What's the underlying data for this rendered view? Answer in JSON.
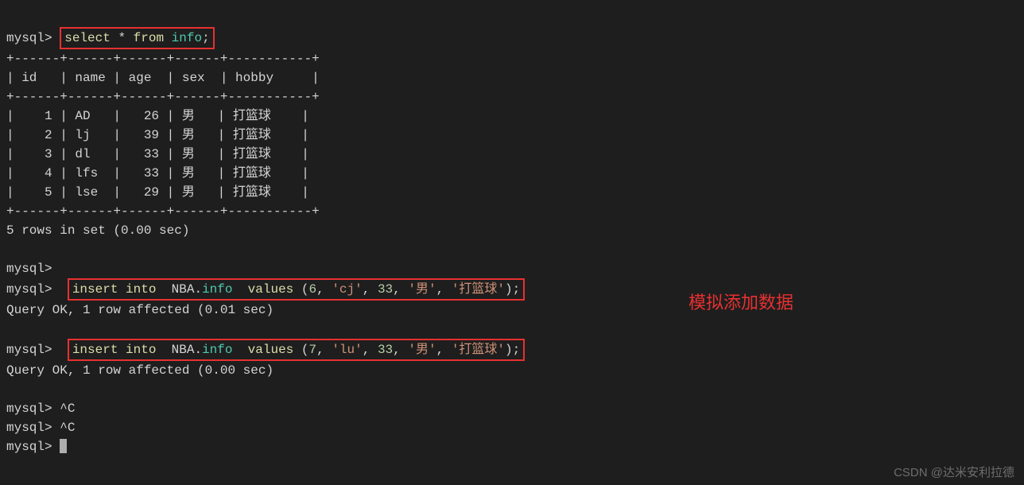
{
  "prompt": "mysql>",
  "query1": {
    "select": "select",
    "star": "*",
    "from": "from",
    "table": "info",
    "semi": ";"
  },
  "table": {
    "border_top": "+------+------+------+------+-----------+",
    "header": "| id   | name | age  | sex  | hobby     |",
    "border_mid": "+------+------+------+------+-----------+",
    "rows": [
      "|    1 | AD   |   26 | 男   | 打篮球    |",
      "|    2 | lj   |   39 | 男   | 打篮球    |",
      "|    3 | dl   |   33 | 男   | 打篮球    |",
      "|    4 | lfs  |   33 | 男   | 打篮球    |",
      "|    5 | lse  |   29 | 男   | 打篮球    |"
    ],
    "border_bot": "+------+------+------+------+-----------+",
    "status": "5 rows in set (0.00 sec)"
  },
  "insert1": {
    "insert": "insert",
    "into": "into",
    "nba": "NBA",
    "dot": ".",
    "table": "info",
    "values": "values",
    "lparen": "(",
    "v_id": "6",
    "comma": ",",
    "v_name": "'cj'",
    "v_age": "33",
    "v_sex": "'男'",
    "v_hobby": "'打篮球'",
    "rparen": ")",
    "semi": ";"
  },
  "insert1_status": "Query OK, 1 row affected (0.01 sec)",
  "insert2": {
    "insert": "insert",
    "into": "into",
    "nba": "NBA",
    "dot": ".",
    "table": "info",
    "values": "values",
    "lparen": "(",
    "v_id": "7",
    "comma": ",",
    "v_name": "'lu'",
    "v_age": "33",
    "v_sex": "'男'",
    "v_hobby": "'打篮球'",
    "rparen": ")",
    "semi": ";"
  },
  "insert2_status": "Query OK, 1 row affected (0.00 sec)",
  "ctrl_c": "^C",
  "annotation": "模拟添加数据",
  "watermark": "CSDN @达米安利拉德"
}
